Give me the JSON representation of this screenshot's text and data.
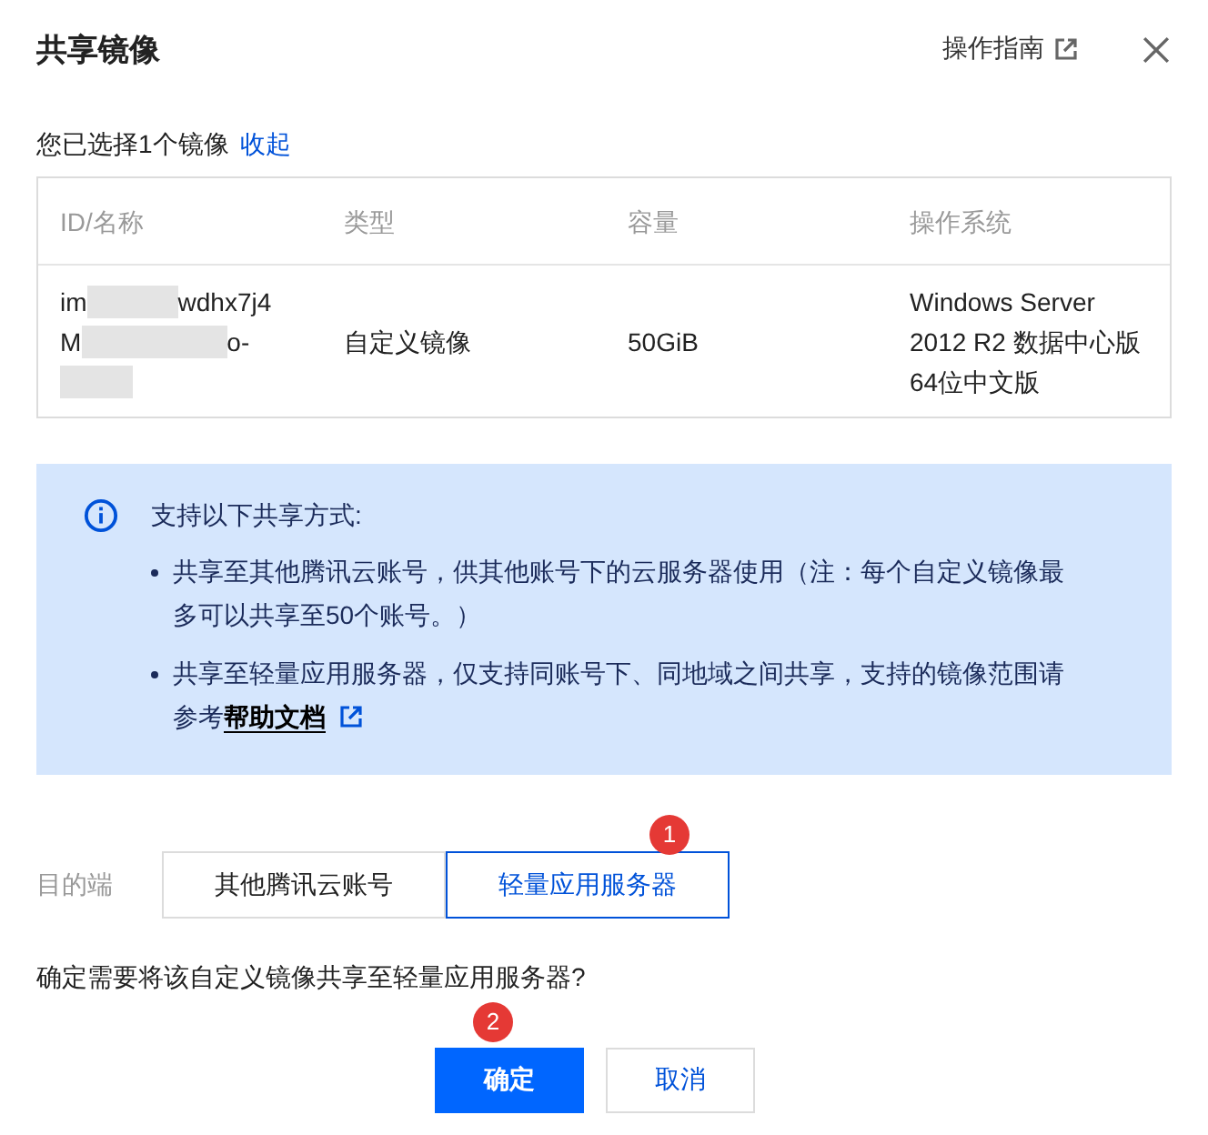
{
  "dialog": {
    "title": "共享镜像",
    "guide_link": "操作指南"
  },
  "selection": {
    "text": "您已选择1个镜像",
    "collapse_link": "收起"
  },
  "table": {
    "columns": [
      "ID/名称",
      "类型",
      "容量",
      "操作系统"
    ],
    "rows": [
      {
        "id_lines": [
          {
            "kind": "partial",
            "start": "im",
            "end": "wdhx7j4"
          },
          {
            "kind": "partial",
            "start": "M",
            "end": "o-"
          },
          {
            "kind": "redacted"
          }
        ],
        "type": "自定义镜像",
        "capacity": "50GiB",
        "os": "Windows Server 2012 R2 数据中心版 64位中文版"
      }
    ]
  },
  "notice": {
    "title": "支持以下共享方式:",
    "items": [
      {
        "text": "共享至其他腾讯云账号，供其他账号下的云服务器使用（注：每个自定义镜像最多可以共享至50个账号。）"
      },
      {
        "text": "共享至轻量应用服务器，仅支持同账号下、同地域之间共享，支持的镜像范围请参考",
        "link": "帮助文档"
      }
    ]
  },
  "destination": {
    "label": "目的端",
    "options": [
      {
        "label": "其他腾讯云账号",
        "selected": false
      },
      {
        "label": "轻量应用服务器",
        "selected": true,
        "badge": "1"
      }
    ]
  },
  "question": "确定需要将该自定义镜像共享至轻量应用服务器?",
  "buttons": [
    {
      "label": "确定",
      "kind": "primary",
      "badge": "2"
    },
    {
      "label": "取消",
      "kind": "secondary"
    }
  ]
}
